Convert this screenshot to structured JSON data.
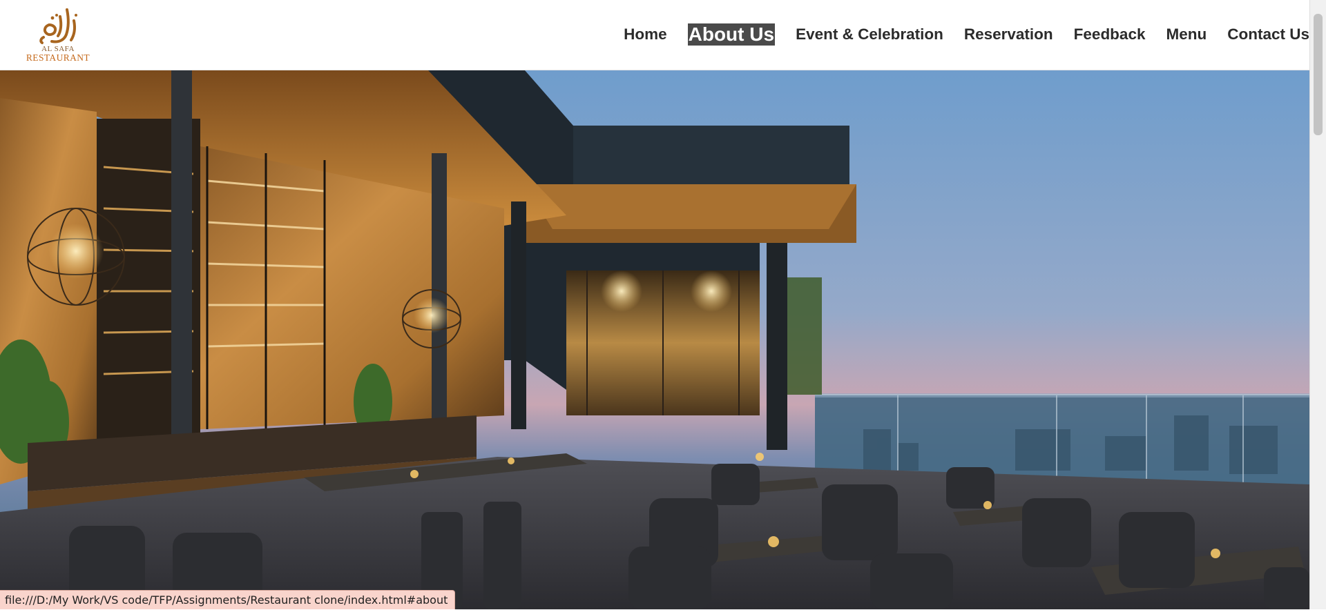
{
  "brand": {
    "arabic_name": "الصفا",
    "name_line1": "AL SAFA",
    "name_line2": "RESTAURANT"
  },
  "nav": {
    "items": [
      {
        "label": "Home"
      },
      {
        "label": "About Us",
        "active": true
      },
      {
        "label": "Event & Celebration"
      },
      {
        "label": "Reservation"
      },
      {
        "label": "Feedback"
      },
      {
        "label": "Menu"
      },
      {
        "label": "Contact Us"
      }
    ]
  },
  "hero": {
    "image": "rooftop-restaurant-photo"
  },
  "status_bar": {
    "url": "file:///D:/My Work/VS code/TFP/Assignments/Restaurant clone/index.html#about"
  },
  "colors": {
    "nav_text": "#2b2b2b",
    "nav_active_bg": "#4a4a4a",
    "nav_active_text": "#ffffff",
    "logo_gold": "#c66a1c",
    "status_bg": "#f9d4cc"
  }
}
